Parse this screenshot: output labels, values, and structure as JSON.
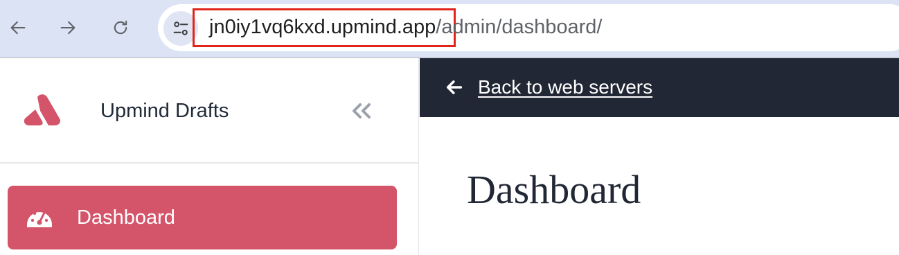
{
  "browser": {
    "url_host": "jn0iy1vq6kxd.upmind.app",
    "url_path": "/admin/dashboard/",
    "highlight_color": "#e1251b",
    "icons": [
      "back-arrow-icon",
      "forward-arrow-icon",
      "reload-icon",
      "site-settings-icon"
    ]
  },
  "sidebar": {
    "app_name": "Upmind Drafts",
    "logo": "upmind-logo",
    "collapse_icon": "double-chevron-left-icon",
    "items": [
      {
        "label": "Dashboard",
        "icon": "dashboard-gauge-icon",
        "active": true
      }
    ],
    "active_color": "#d4546a"
  },
  "main": {
    "back_link_label": "Back to web servers",
    "back_icon": "arrow-left-icon",
    "page_title": "Dashboard",
    "topbar_color": "#212734"
  }
}
